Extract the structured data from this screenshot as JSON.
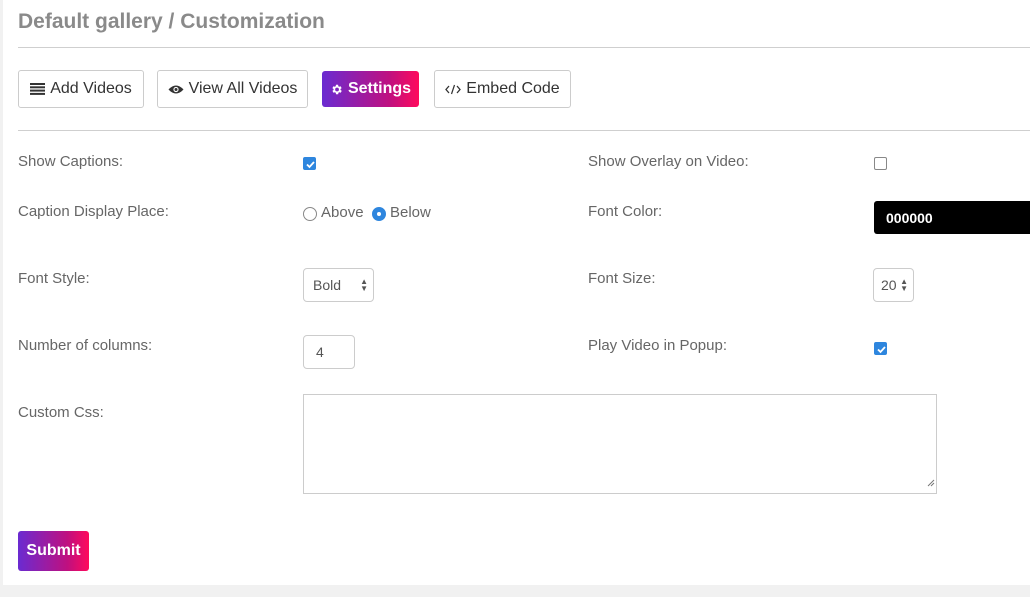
{
  "page": {
    "title": "Default gallery / Customization"
  },
  "toolbar": {
    "add_videos": "Add Videos",
    "view_all_videos": "View All Videos",
    "settings": "Settings",
    "embed_code": "Embed Code"
  },
  "form": {
    "show_captions": {
      "label": "Show Captions:",
      "checked": true
    },
    "show_overlay": {
      "label": "Show Overlay on Video:",
      "checked": false
    },
    "caption_display_place": {
      "label": "Caption Display Place:",
      "options": [
        "Above",
        "Below"
      ],
      "selected": "Below"
    },
    "font_color": {
      "label": "Font Color:",
      "value": "000000"
    },
    "font_style": {
      "label": "Font Style:",
      "value": "Bold"
    },
    "font_size": {
      "label": "Font Size:",
      "value": "20"
    },
    "columns": {
      "label": "Number of columns:",
      "value": "4"
    },
    "play_popup": {
      "label": "Play Video in Popup:",
      "checked": true
    },
    "custom_css": {
      "label": "Custom Css:",
      "value": ""
    },
    "submit_label": "Submit"
  },
  "colors": {
    "accent_start": "#6a2bd1",
    "accent_end": "#ff0a5c",
    "checkbox_blue": "#2e86de",
    "font_color_swatch": "#000000"
  },
  "icons": {
    "add_videos": "list-icon",
    "view_all_videos": "eye-icon",
    "settings": "gear-icon",
    "embed_code": "code-icon"
  }
}
